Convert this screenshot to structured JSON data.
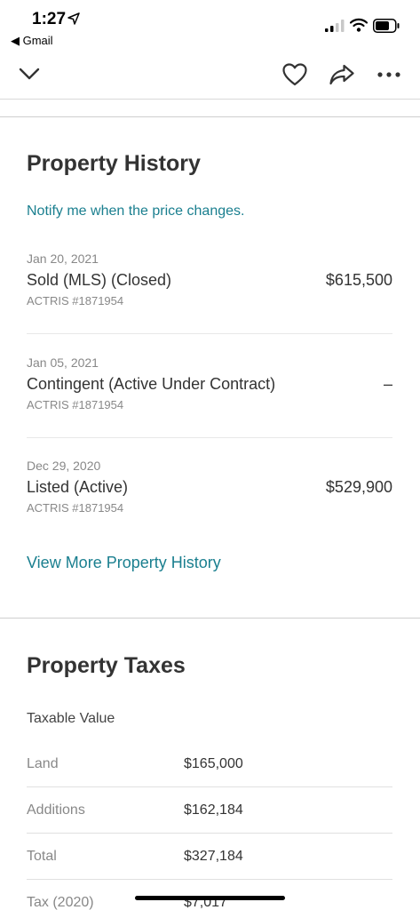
{
  "status_bar": {
    "time": "1:27",
    "back_app": "◀ Gmail"
  },
  "toolbar": {
    "icons": [
      "chevron-down-icon",
      "heart-icon",
      "share-icon",
      "more-icon"
    ]
  },
  "history": {
    "title": "Property History",
    "notify_link": "Notify me when the price changes.",
    "items": [
      {
        "date": "Jan 20, 2021",
        "event": "Sold (MLS) (Closed)",
        "price": "$615,500",
        "source": "ACTRIS #1871954"
      },
      {
        "date": "Jan 05, 2021",
        "event": "Contingent (Active Under Contract)",
        "price": "–",
        "source": "ACTRIS #1871954"
      },
      {
        "date": "Dec 29, 2020",
        "event": "Listed (Active)",
        "price": "$529,900",
        "source": "ACTRIS #1871954"
      }
    ],
    "view_more_link": "View More Property History"
  },
  "taxes": {
    "title": "Property Taxes",
    "subtitle": "Taxable Value",
    "rows": [
      {
        "label": "Land",
        "value": "$165,000"
      },
      {
        "label": "Additions",
        "value": "$162,184"
      },
      {
        "label": "Total",
        "value": "$327,184"
      },
      {
        "label": "Tax (2020)",
        "value": "$7,017"
      }
    ]
  },
  "colors": {
    "link": "#1a7f8f",
    "text": "#333333",
    "muted": "#888888"
  }
}
